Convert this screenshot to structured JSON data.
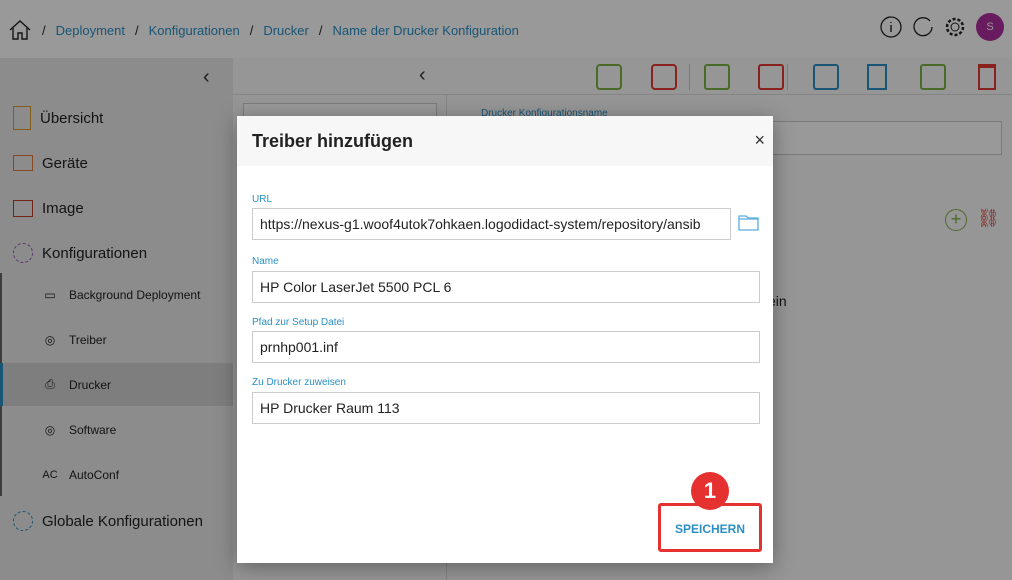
{
  "breadcrumb": {
    "items": [
      "Deployment",
      "Konfigurationen",
      "Drucker",
      "Name der Drucker Konfiguration"
    ],
    "separator": "/"
  },
  "header": {
    "avatar_initial": "S",
    "icons": [
      "info-icon",
      "refresh-icon",
      "gear-icon"
    ]
  },
  "sidebar": {
    "items": [
      {
        "label": "Übersicht",
        "icon": "overview-icon"
      },
      {
        "label": "Geräte",
        "icon": "devices-icon"
      },
      {
        "label": "Image",
        "icon": "image-icon"
      },
      {
        "label": "Konfigurationen",
        "icon": "config-icon"
      }
    ],
    "subitems": [
      {
        "label": "Background Deployment"
      },
      {
        "label": "Treiber"
      },
      {
        "label": "Drucker",
        "selected": true
      },
      {
        "label": "Software"
      },
      {
        "label": "AutoConf"
      }
    ],
    "global": "Globale Konfigurationen"
  },
  "main": {
    "config_name_label": "Drucker Konfigurationsname",
    "partial_text": "ein"
  },
  "modal": {
    "title": "Treiber hinzufügen",
    "close": "×",
    "fields": [
      {
        "label": "URL",
        "value": "https://nexus-g1.woof4utok7ohkaen.logodidact-system/repository/ansib"
      },
      {
        "label": "Name",
        "value": "HP Color LaserJet 5500 PCL 6"
      },
      {
        "label": "Pfad zur Setup Datei",
        "value": "prnhp001.inf"
      },
      {
        "label": "Zu Drucker zuweisen",
        "value": "HP Drucker Raum 113"
      }
    ],
    "save_label": "SPEICHERN"
  },
  "annotation": {
    "step": "1",
    "color": "#e5312f"
  },
  "colors": {
    "accent": "#2a8fc4",
    "green": "#7cb342",
    "red": "#e53935"
  }
}
